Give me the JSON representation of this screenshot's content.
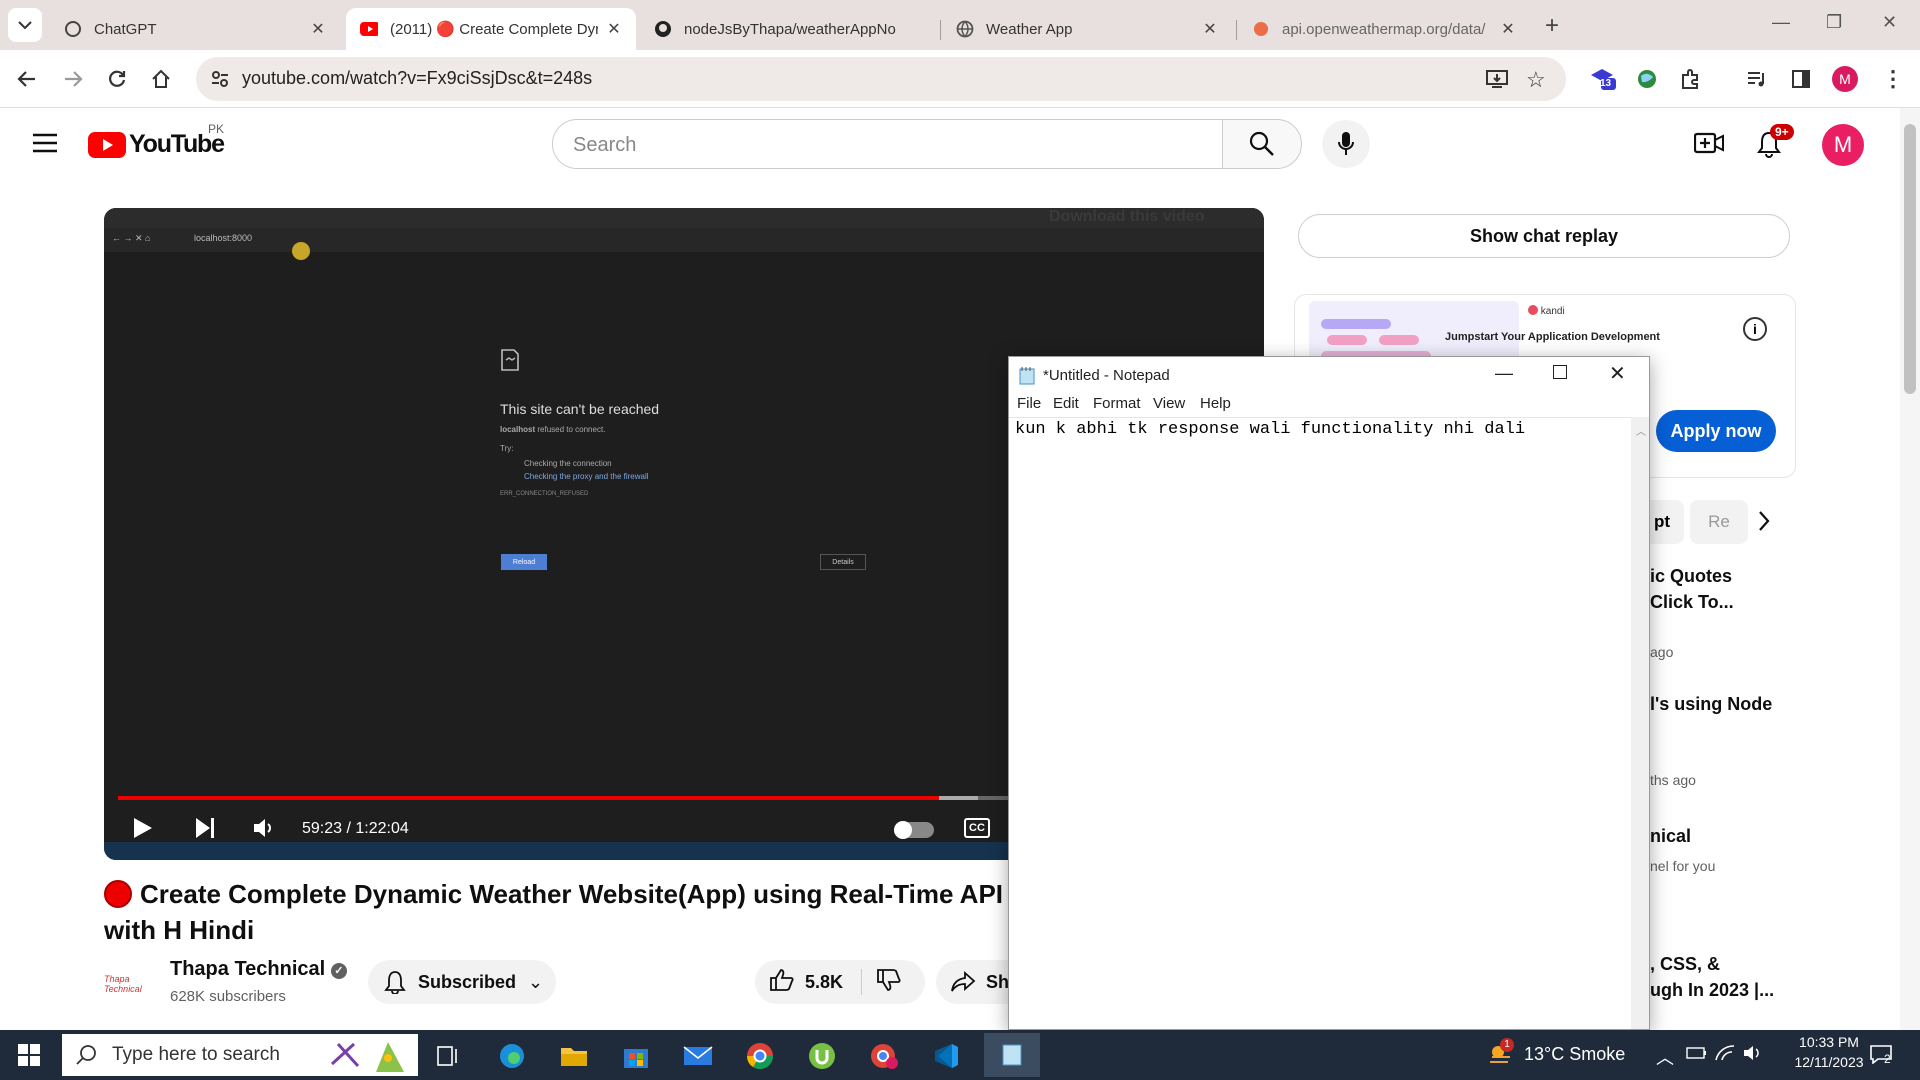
{
  "browser": {
    "tabs": [
      {
        "title": "ChatGPT",
        "active": false
      },
      {
        "title": "(2011) 🔴 Create Complete Dyr",
        "active": true
      },
      {
        "title": "nodeJsByThapa/weatherAppNo",
        "active": false
      },
      {
        "title": "Weather App",
        "active": false
      },
      {
        "title": "api.openweathermap.org/data/",
        "active": false
      }
    ],
    "url": "youtube.com/watch?v=Fx9ciSsjDsc&t=248s",
    "extension_badge": "13",
    "profile_initial": "M"
  },
  "youtube": {
    "logo_text": "YouTube",
    "region": "PK",
    "search_placeholder": "Search",
    "notification_badge": "9+",
    "avatar_initial": "M"
  },
  "video": {
    "inner_url": "localhost:8000",
    "overlay_text": "Download this video",
    "error_title": "This site can't be reached",
    "error_host": "localhost",
    "error_msg": "refused to connect.",
    "error_try": "Try:",
    "error_tip1": "Checking the connection",
    "error_tip2": "Checking the proxy and the firewall",
    "error_code": "ERR_CONNECTION_REFUSED",
    "reload_label": "Reload",
    "details_label": "Details",
    "time_display": "59:23 / 1:22:04",
    "progress_fraction": 0.723,
    "cc_label": "CC"
  },
  "video_info": {
    "title": "Create Complete Dynamic Weather Website(App) using Real-Time API with H Hindi",
    "channel": "Thapa Technical",
    "subscribers": "628K subscribers",
    "subscribe_label": "Subscribed",
    "likes": "5.8K",
    "share_label": "Sha"
  },
  "sidebar": {
    "chat_replay": "Show chat replay",
    "ad_brand": "kandi",
    "ad_title": "Jumpstart Your Application Development",
    "ad_button": "Apply now",
    "chips": [
      "pt",
      "Re"
    ],
    "items": [
      {
        "line1": "ic Quotes",
        "line2": "Click To...",
        "meta": "ago"
      },
      {
        "line1": "l's using Node",
        "line2": "",
        "meta": "ths ago"
      },
      {
        "line1": "nical",
        "line2": "",
        "meta": "nel for you"
      },
      {
        "line1": ", CSS, &",
        "line2": "ugh In 2023 |...",
        "meta": ""
      }
    ]
  },
  "notepad": {
    "title": "*Untitled - Notepad",
    "menu": [
      "File",
      "Edit",
      "Format",
      "View",
      "Help"
    ],
    "content": "kun k abhi tk response wali functionality nhi dali"
  },
  "taskbar": {
    "search_placeholder": "Type here to search",
    "weather": "13°C  Smoke",
    "weather_badge": "1",
    "time": "10:33 PM",
    "date": "12/11/2023",
    "notif_count": "2"
  }
}
